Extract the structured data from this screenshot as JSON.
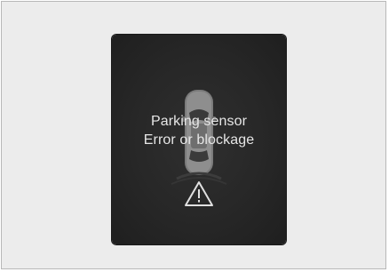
{
  "screen": {
    "title_line1": "Parking sensor",
    "title_line2": "Error or blockage",
    "icons": [
      "car-top-view-icon",
      "warning-triangle-icon",
      "sensor-wave-icon"
    ],
    "colors": {
      "display_background": "#262626",
      "text": "#e6e6e6",
      "car_body": "#8a8a8a",
      "frame_background": "#ececec"
    }
  }
}
